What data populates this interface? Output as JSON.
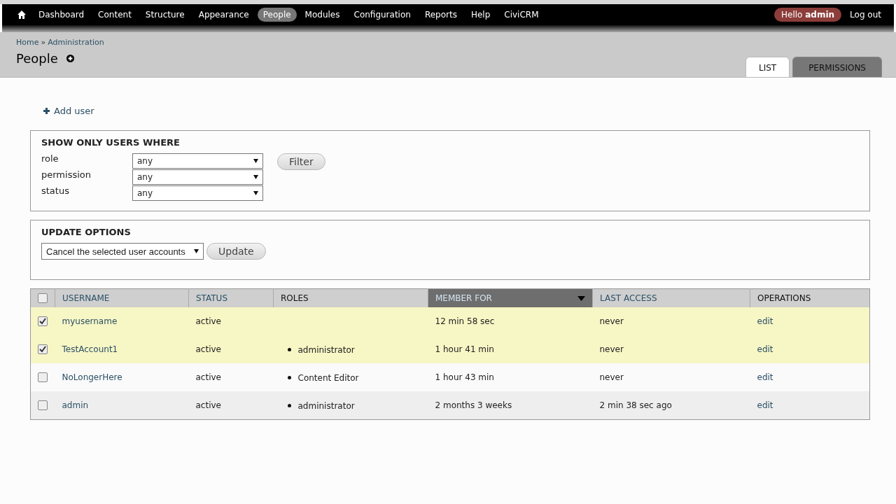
{
  "toolbar": {
    "menu": [
      {
        "label": "Dashboard",
        "selected": false
      },
      {
        "label": "Content",
        "selected": false
      },
      {
        "label": "Structure",
        "selected": false
      },
      {
        "label": "Appearance",
        "selected": false
      },
      {
        "label": "People",
        "selected": true
      },
      {
        "label": "Modules",
        "selected": false
      },
      {
        "label": "Configuration",
        "selected": false
      },
      {
        "label": "Reports",
        "selected": false
      },
      {
        "label": "Help",
        "selected": false
      },
      {
        "label": "CiviCRM",
        "selected": false
      }
    ],
    "greeting": "Hello **admin**",
    "logout": "Log out"
  },
  "breadcrumb": [
    "Home",
    "Administration"
  ],
  "breadcrumb_separator": "»",
  "page_title": "People",
  "tabs": [
    {
      "label": "LIST",
      "selected": true
    },
    {
      "label": "PERMISSIONS",
      "selected": false
    }
  ],
  "add_link": "Add user",
  "filter": {
    "title": "SHOW ONLY USERS WHERE",
    "fields": [
      {
        "label": "role",
        "value": "any"
      },
      {
        "label": "permission",
        "value": "any"
      },
      {
        "label": "status",
        "value": "any"
      }
    ],
    "button": "Filter"
  },
  "update": {
    "title": "UPDATE OPTIONS",
    "value": "Cancel the selected user accounts",
    "button": "Update"
  },
  "table": {
    "select_all": {
      "checked": false
    },
    "columns": [
      {
        "label": "USERNAME",
        "sortable": true,
        "selected": false
      },
      {
        "label": "STATUS",
        "sortable": true,
        "selected": false
      },
      {
        "label": "ROLES",
        "sortable": false,
        "selected": false
      },
      {
        "label": "MEMBER FOR",
        "sortable": true,
        "selected": true
      },
      {
        "label": "LAST ACCESS",
        "sortable": true,
        "selected": false
      },
      {
        "label": "OPERATIONS",
        "sortable": false,
        "selected": false
      }
    ],
    "rows": [
      {
        "selected": true,
        "username": "myusername",
        "status": "active",
        "roles": [],
        "member_for": "12 min 58 sec",
        "last_access": "never",
        "operation": "edit"
      },
      {
        "selected": true,
        "username": "TestAccount1",
        "status": "active",
        "roles": [
          "administrator"
        ],
        "member_for": "1 hour 41 min",
        "last_access": "never",
        "operation": "edit"
      },
      {
        "selected": false,
        "username": "NoLongerHere",
        "status": "active",
        "roles": [
          "Content Editor"
        ],
        "member_for": "1 hour 43 min",
        "last_access": "never",
        "operation": "edit"
      },
      {
        "selected": false,
        "username": "admin",
        "status": "active",
        "roles": [
          "administrator"
        ],
        "member_for": "2 months 3 weeks",
        "last_access": "2 min 38 sec ago",
        "operation": "edit"
      }
    ]
  }
}
